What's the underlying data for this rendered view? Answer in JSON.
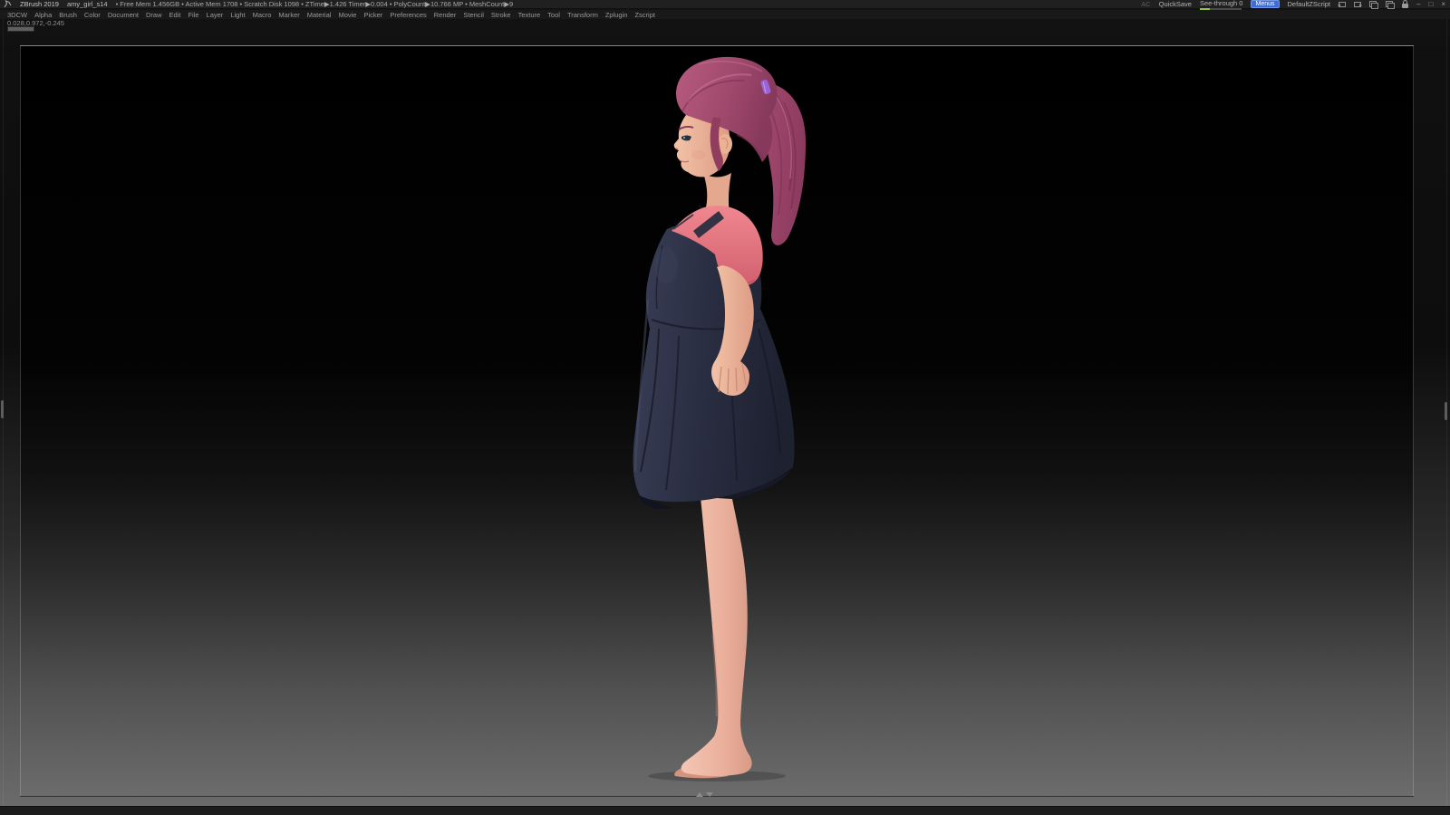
{
  "titlebar": {
    "app_name": "ZBrush 2019",
    "document_name": "amy_girl_s14",
    "stats": "• Free Mem 1.456GB • Active Mem 1708 • Scratch Disk 1098 •  ZTime▶1.426 Timer▶0.004 • PolyCount▶10.766 MP • MeshCount▶9",
    "ac_label": "AC",
    "quicksave_label": "QuickSave",
    "see_through_label": "See-through 0",
    "menus_button_label": "Menus",
    "zscript_button_label": "DefaultZScript",
    "window_controls": {
      "minimize": "–",
      "restore": "□",
      "close": "×"
    }
  },
  "menu_bar": {
    "items": [
      "3DCW",
      "Alpha",
      "Brush",
      "Color",
      "Document",
      "Draw",
      "Edit",
      "File",
      "Layer",
      "Light",
      "Macro",
      "Marker",
      "Material",
      "Movie",
      "Picker",
      "Preferences",
      "Render",
      "Stencil",
      "Stroke",
      "Texture",
      "Tool",
      "Transform",
      "Zplugin",
      "Zscript"
    ]
  },
  "status": {
    "cursor_coordinates": "0.028,0.972,-0.245"
  },
  "viewport": {
    "background_top": "#000000",
    "background_bottom": "#6a6a6a",
    "model_colors": {
      "hair": "#a54a6f",
      "hair_dark": "#7c2f50",
      "hair_tie": "#9a63d8",
      "skin": "#eebba1",
      "shirt": "#e2737e",
      "dress": "#2a2e40"
    }
  },
  "icons": {
    "zbrush_logo": "sculptor-glyph",
    "layout_prev": "box-arrow-left",
    "layout_next": "box-arrow-right",
    "copy_ui": "double-box",
    "paste_ui": "double-box",
    "lock": "padlock",
    "divider_grips": "resize-handles"
  }
}
